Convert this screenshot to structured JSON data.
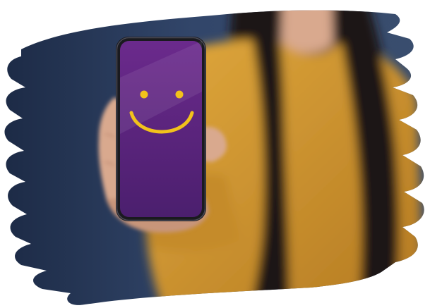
{
  "scene": {
    "background_color": "#ffffff",
    "backdrop_color": "#2f425f",
    "backdrop_edge_color": "#1f2d44",
    "sweater_color": "#d69a33",
    "sweater_shadow_color": "#b47a22",
    "hair_color": "#1b1512",
    "skin_color": "#d9a98e",
    "skin_shadow_color": "#b9836a"
  },
  "phone": {
    "frame_color": "#1a1a1f",
    "screen_color_top": "#6b2a8c",
    "screen_color_bottom": "#4b1f6e",
    "smiley_color": "#f2c21b",
    "smiley_icon": "smiley-face-icon"
  }
}
